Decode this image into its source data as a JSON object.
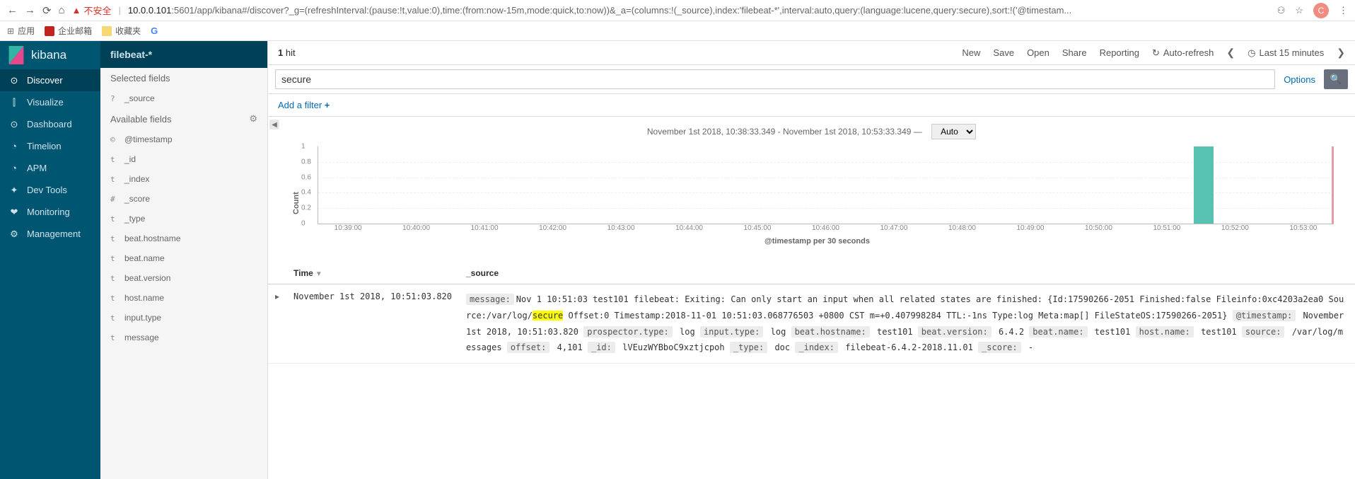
{
  "browser": {
    "warn_text": "不安全",
    "url_host": "10.0.0.101",
    "url_path": ":5601/app/kibana#/discover?_g=(refreshInterval:(pause:!t,value:0),time:(from:now-15m,mode:quick,to:now))&_a=(columns:!(_source),index:'filebeat-*',interval:auto,query:(language:lucene,query:secure),sort:!('@timestam...",
    "avatar_letter": "C",
    "bookmarks": {
      "apps": "应用",
      "mail": "企业邮箱",
      "fav": "收藏夹"
    }
  },
  "kibana_logo": "kibana",
  "sidebar": {
    "items": [
      {
        "icon": "⊙",
        "label": "Discover",
        "active": true
      },
      {
        "icon": "⫿",
        "label": "Visualize"
      },
      {
        "icon": "⊙",
        "label": "Dashboard"
      },
      {
        "icon": "◔",
        "label": "Timelion"
      },
      {
        "icon": "◔",
        "label": "APM"
      },
      {
        "icon": "✦",
        "label": "Dev Tools"
      },
      {
        "icon": "❤",
        "label": "Monitoring"
      },
      {
        "icon": "⚙",
        "label": "Management"
      }
    ]
  },
  "fields": {
    "index_name": "filebeat-*",
    "selected_title": "Selected fields",
    "selected": [
      {
        "b": "?",
        "name": "_source"
      }
    ],
    "avail_title": "Available fields",
    "avail_gear": "⚙",
    "available": [
      {
        "b": "©",
        "name": "@timestamp"
      },
      {
        "b": "t",
        "name": "_id"
      },
      {
        "b": "t",
        "name": "_index"
      },
      {
        "b": "#",
        "name": "_score"
      },
      {
        "b": "t",
        "name": "_type"
      },
      {
        "b": "t",
        "name": "beat.hostname"
      },
      {
        "b": "t",
        "name": "beat.name"
      },
      {
        "b": "t",
        "name": "beat.version"
      },
      {
        "b": "t",
        "name": "host.name"
      },
      {
        "b": "t",
        "name": "input.type"
      },
      {
        "b": "t",
        "name": "message"
      }
    ]
  },
  "topbar": {
    "hits_count": "1",
    "hits_label": " hit",
    "links": [
      "New",
      "Save",
      "Open",
      "Share",
      "Reporting"
    ],
    "auto_refresh": "Auto-refresh",
    "time_label": "Last 15 minutes"
  },
  "search": {
    "value": "secure",
    "options": "Options"
  },
  "filter": {
    "add": "Add a filter",
    "plus": "+"
  },
  "chart_header": {
    "range": "November 1st 2018, 10:38:33.349 - November 1st 2018, 10:53:33.349 —",
    "interval": "Auto"
  },
  "chart_data": {
    "type": "bar",
    "ylabel": "Count",
    "xlabel": "@timestamp per 30 seconds",
    "ylim": [
      0,
      1
    ],
    "yticks": [
      "0",
      "0.2",
      "0.4",
      "0.6",
      "0.8",
      "1"
    ],
    "xticks": [
      "10:39:00",
      "10:40:00",
      "10:41:00",
      "10:42:00",
      "10:43:00",
      "10:44:00",
      "10:45:00",
      "10:46:00",
      "10:47:00",
      "10:48:00",
      "10:49:00",
      "10:50:00",
      "10:51:00",
      "10:52:00",
      "10:53:00"
    ],
    "bars": [
      {
        "x": "10:51:00",
        "value": 1
      }
    ]
  },
  "table": {
    "headers": {
      "time": "Time",
      "source": "_source"
    },
    "row": {
      "ts": "November 1st 2018, 10:51:03.820",
      "message_pre": "Nov 1 10:51:03 test101 filebeat: Exiting: Can only start an input when all related states are finished: {Id:17590266-2051 Finished:false Fileinfo:0xc4203a2ea0 Source:/var/log/",
      "message_hl": "secure",
      "message_post": " Offset:0 Timestamp:2018-11-01 10:51:03.068776503 +0800 CST m=+0.407998284 TTL:-1ns Type:log Meta:map[] FileStateOS:17590266-2051}",
      "timestamp_val": "November 1st 2018, 10:51:03.820",
      "prospector_type": "log",
      "input_type": "log",
      "beat_hostname": "test101",
      "beat_version": "6.4.2",
      "beat_name": "test101",
      "host_name": "test101",
      "source_val": "/var/log/messages",
      "offset": "4,101",
      "id_val": "lVEuzWYBboC9xztjcpoh",
      "type_val": "doc",
      "index_val": "filebeat-6.4.2-2018.11.01",
      "score_val": " - "
    },
    "labels": {
      "message": "message:",
      "timestamp": "@timestamp:",
      "prospector_type": "prospector.type:",
      "input_type": "input.type:",
      "beat_hostname": "beat.hostname:",
      "beat_version": "beat.version:",
      "beat_name": "beat.name:",
      "host_name": "host.name:",
      "source": "source:",
      "offset": "offset:",
      "id": "_id:",
      "type": "_type:",
      "index": "_index:",
      "score": "_score:"
    }
  }
}
